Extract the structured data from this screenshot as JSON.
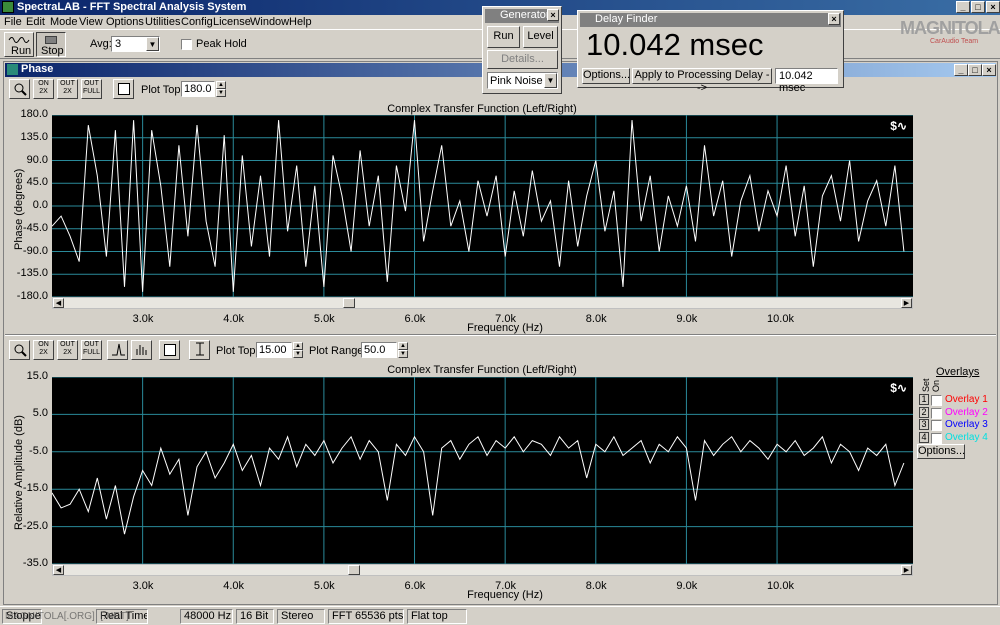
{
  "app": {
    "title": "SpectraLAB - FFT Spectral Analysis System",
    "window_buttons": [
      "_",
      "□",
      "×"
    ]
  },
  "menu": [
    "File",
    "Edit",
    "Mode",
    "View",
    "Options",
    "Utilities",
    "Config",
    "License",
    "Window",
    "Help"
  ],
  "toolbar": {
    "run_label": "Run",
    "stop_label": "Stop",
    "avg_label": "Avg:",
    "avg_value": "3",
    "peak_hold_label": "Peak Hold"
  },
  "generator": {
    "title": "Generator",
    "run_label": "Run",
    "level_label": "Level",
    "details_label": "Details...",
    "noise_value": "Pink Noise"
  },
  "delay_finder": {
    "title": "Delay Finder",
    "value": "10.042 msec",
    "options_label": "Options...",
    "apply_label": "Apply to Processing Delay -->",
    "field_value": "10.042 msec"
  },
  "watermark": {
    "brand": "MAGNITOLA",
    "sub": "CarAudio Team"
  },
  "phase_window": {
    "title": "Phase",
    "icons": [
      "zoom-icon",
      "zoom-in-2x-icon",
      "zoom-out-2x-icon",
      "zoom-out-full-icon",
      "settings-icon"
    ],
    "icon_labels": [
      "",
      "ON 2X",
      "OUT 2X",
      "OUT FULL",
      ""
    ],
    "plot_top_label": "Plot Top:",
    "plot_top_value": "180.0",
    "chart_title": "Complex Transfer Function (Left/Right)",
    "ylabel": "Phase (degrees)",
    "xlabel": "Frequency (Hz)",
    "yticks": [
      "180.0",
      "135.0",
      "90.0",
      "45.0",
      "0.0",
      "-45.0",
      "-90.0",
      "-135.0",
      "-180.0"
    ],
    "xticks": [
      "3.0k",
      "4.0k",
      "5.0k",
      "6.0k",
      "7.0k",
      "8.0k",
      "9.0k",
      "10.0k"
    ]
  },
  "amp_window": {
    "plot_top_label": "Plot Top:",
    "plot_top_value": "15.00",
    "plot_range_label": "Plot Range:",
    "plot_range_value": "50.0",
    "chart_title": "Complex Transfer Function (Left/Right)",
    "ylabel": "Relative Amplitude (dB)",
    "xlabel": "Frequency (Hz)",
    "yticks": [
      "15.0",
      "5.0",
      "-5.0",
      "-15.0",
      "-25.0",
      "-35.0"
    ],
    "xticks": [
      "3.0k",
      "4.0k",
      "5.0k",
      "6.0k",
      "7.0k",
      "8.0k",
      "9.0k",
      "10.0k"
    ],
    "overlays": {
      "title": "Overlays",
      "set_label": "Set",
      "on_label": "On",
      "items": [
        {
          "num": "1",
          "label": "Overlay 1",
          "color": "#ff0000"
        },
        {
          "num": "2",
          "label": "Overlay 2",
          "color": "#ff00ff"
        },
        {
          "num": "3",
          "label": "Overlay 3",
          "color": "#0000ff"
        },
        {
          "num": "4",
          "label": "Overlay 4",
          "color": "#00e0e0"
        }
      ],
      "options_label": "Options..."
    }
  },
  "statusbar": {
    "cells": [
      "Stopped",
      "Real Time",
      "48000 Hz",
      "16 Bit",
      "Stereo",
      "FFT 65536 pts",
      "Flat top"
    ],
    "watermark": "MAGNITOLA[.ORG]  [.NET]"
  },
  "chart_data": [
    {
      "type": "line",
      "title": "Complex Transfer Function (Left/Right)",
      "xlabel": "Frequency (Hz)",
      "ylabel": "Phase (degrees)",
      "ylim": [
        -180,
        180
      ],
      "xlim": [
        2000,
        11500
      ],
      "grid": true,
      "series": [
        {
          "x": [
            2000,
            2100,
            2200,
            2300,
            2400,
            2500,
            2600,
            2700,
            2800,
            2900,
            3000,
            3100,
            3200,
            3300,
            3400,
            3500,
            3600,
            3700,
            3800,
            3900,
            4000,
            4100,
            4200,
            4300,
            4400,
            4500,
            4600,
            4700,
            4800,
            4900,
            5000,
            5100,
            5200,
            5300,
            5400,
            5500,
            5600,
            5700,
            5800,
            5900,
            6000,
            6100,
            6200,
            6300,
            6400,
            6500,
            6600,
            6700,
            6800,
            6900,
            7000,
            7100,
            7200,
            7300,
            7400,
            7500,
            7600,
            7700,
            7800,
            7900,
            8000,
            8100,
            8200,
            8300,
            8400,
            8500,
            8600,
            8700,
            8800,
            8900,
            9000,
            9100,
            9200,
            9300,
            9400,
            9500,
            9600,
            9700,
            9800,
            9900,
            10000,
            10100,
            10200,
            10300,
            10400,
            10500,
            10600,
            10700,
            10800,
            10900,
            11000,
            11100,
            11200,
            11300,
            11400
          ],
          "values": [
            -40,
            -20,
            -60,
            -110,
            160,
            60,
            -100,
            150,
            -160,
            170,
            -170,
            150,
            40,
            -120,
            120,
            -60,
            160,
            -30,
            -120,
            140,
            -170,
            100,
            -80,
            60,
            -100,
            170,
            -50,
            80,
            -120,
            40,
            -160,
            100,
            20,
            -90,
            110,
            -40,
            60,
            -150,
            80,
            -10,
            170,
            -70,
            30,
            120,
            -40,
            10,
            -90,
            50,
            -20,
            60,
            -100,
            30,
            -60,
            70,
            -30,
            10,
            -120,
            50,
            -80,
            20,
            90,
            -50,
            30,
            -160,
            170,
            -30,
            60,
            -90,
            20,
            -40,
            40,
            -70,
            120,
            -20,
            50,
            -100,
            10,
            60,
            -50,
            30,
            -20,
            80,
            -60,
            40,
            -120,
            20,
            60,
            -30,
            90,
            -70,
            10,
            50,
            -40,
            80,
            -90
          ]
        }
      ]
    },
    {
      "type": "line",
      "title": "Complex Transfer Function (Left/Right)",
      "xlabel": "Frequency (Hz)",
      "ylabel": "Relative Amplitude (dB)",
      "ylim": [
        -35,
        15
      ],
      "xlim": [
        2000,
        11500
      ],
      "grid": true,
      "series": [
        {
          "x": [
            2000,
            2100,
            2200,
            2300,
            2400,
            2500,
            2600,
            2700,
            2800,
            2900,
            3000,
            3100,
            3200,
            3300,
            3400,
            3500,
            3600,
            3700,
            3800,
            3900,
            4000,
            4100,
            4200,
            4300,
            4400,
            4500,
            4600,
            4700,
            4800,
            4900,
            5000,
            5100,
            5200,
            5300,
            5400,
            5500,
            5600,
            5700,
            5800,
            5900,
            6000,
            6100,
            6200,
            6300,
            6400,
            6500,
            6600,
            6700,
            6800,
            6900,
            7000,
            7100,
            7200,
            7300,
            7400,
            7500,
            7600,
            7700,
            7800,
            7900,
            8000,
            8100,
            8200,
            8300,
            8400,
            8500,
            8600,
            8700,
            8800,
            8900,
            9000,
            9100,
            9200,
            9300,
            9400,
            9500,
            9600,
            9700,
            9800,
            9900,
            10000,
            10100,
            10200,
            10300,
            10400,
            10500,
            10600,
            10700,
            10800,
            10900,
            11000,
            11100,
            11200,
            11300,
            11400
          ],
          "values": [
            -16,
            -20,
            -19,
            -15,
            -21,
            -12,
            -23,
            -14,
            -27,
            -17,
            -10,
            -14,
            -4,
            -11,
            -7,
            -22,
            -9,
            -5,
            -12,
            -8,
            -3,
            -10,
            -6,
            -14,
            -4,
            -7,
            -1,
            -9,
            -3,
            -6,
            -2,
            -8,
            -4,
            -1,
            -7,
            -2,
            -5,
            -18,
            -3,
            -6,
            -1,
            -5,
            -22,
            -4,
            -2,
            -7,
            -3,
            -1,
            -6,
            -2,
            -4,
            -1,
            -5,
            -2,
            -3,
            -6,
            -1,
            -4,
            -2,
            -12,
            -3,
            -5,
            -1,
            -6,
            -4,
            -2,
            -8,
            -3,
            -5,
            -1,
            -4,
            -18,
            -2,
            -6,
            -3,
            -1,
            -5,
            -2,
            -4,
            -7,
            -3,
            -5,
            -2,
            -6,
            -4,
            -1,
            -8,
            -3,
            -5,
            -10,
            -4,
            -6,
            -3,
            -14,
            -8
          ]
        }
      ]
    }
  ]
}
